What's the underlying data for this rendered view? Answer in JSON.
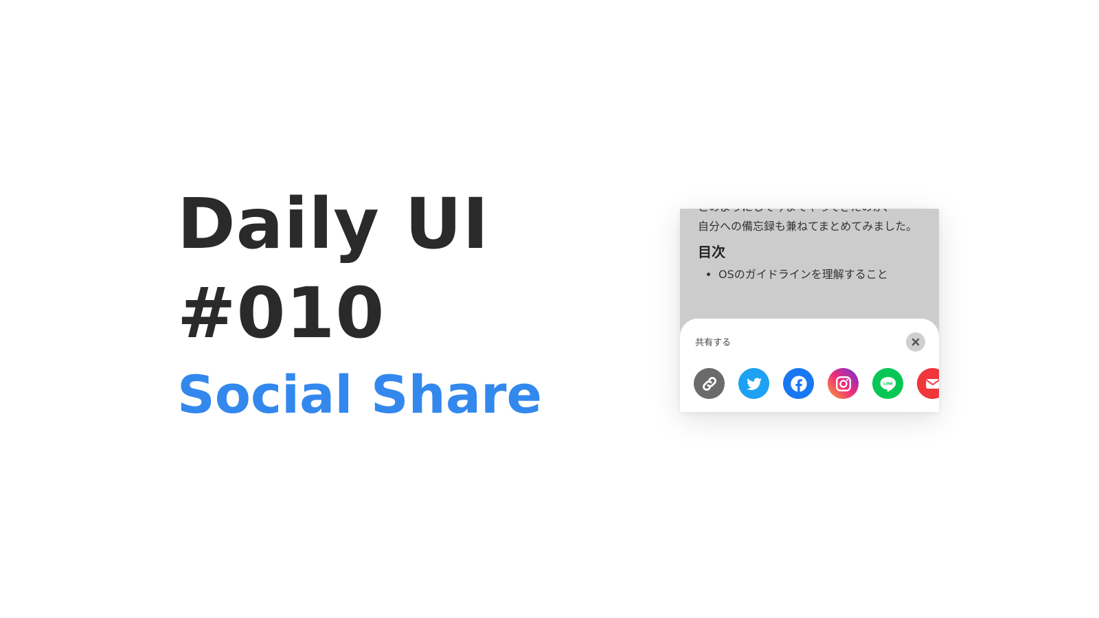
{
  "headline": {
    "line1": "Daily UI",
    "line2": "#010",
    "subtitle": "Social Share"
  },
  "article": {
    "para_top": "このようにして今までやってきたのか、",
    "para_main": "自分への備忘録も兼ねてまとめてみました。",
    "toc_heading": "目次",
    "toc_items": [
      "OSのガイドラインを理解すること"
    ]
  },
  "share_sheet": {
    "title": "共有する",
    "buttons": [
      {
        "id": "link",
        "icon": "link-icon",
        "color": "#6b6b6b"
      },
      {
        "id": "twitter",
        "icon": "twitter-icon",
        "color": "#1da1f2"
      },
      {
        "id": "facebook",
        "icon": "facebook-icon",
        "color": "#1877f2"
      },
      {
        "id": "instagram",
        "icon": "instagram-icon",
        "color": "#e1306c"
      },
      {
        "id": "line",
        "icon": "line-icon",
        "color": "#06c755"
      },
      {
        "id": "mail",
        "icon": "mail-icon",
        "color": "#f0353b"
      }
    ],
    "line_icon_label": "LINE"
  },
  "colors": {
    "title": "#2a2a2a",
    "accent": "#3388ee",
    "overlay": "#cccccc"
  }
}
